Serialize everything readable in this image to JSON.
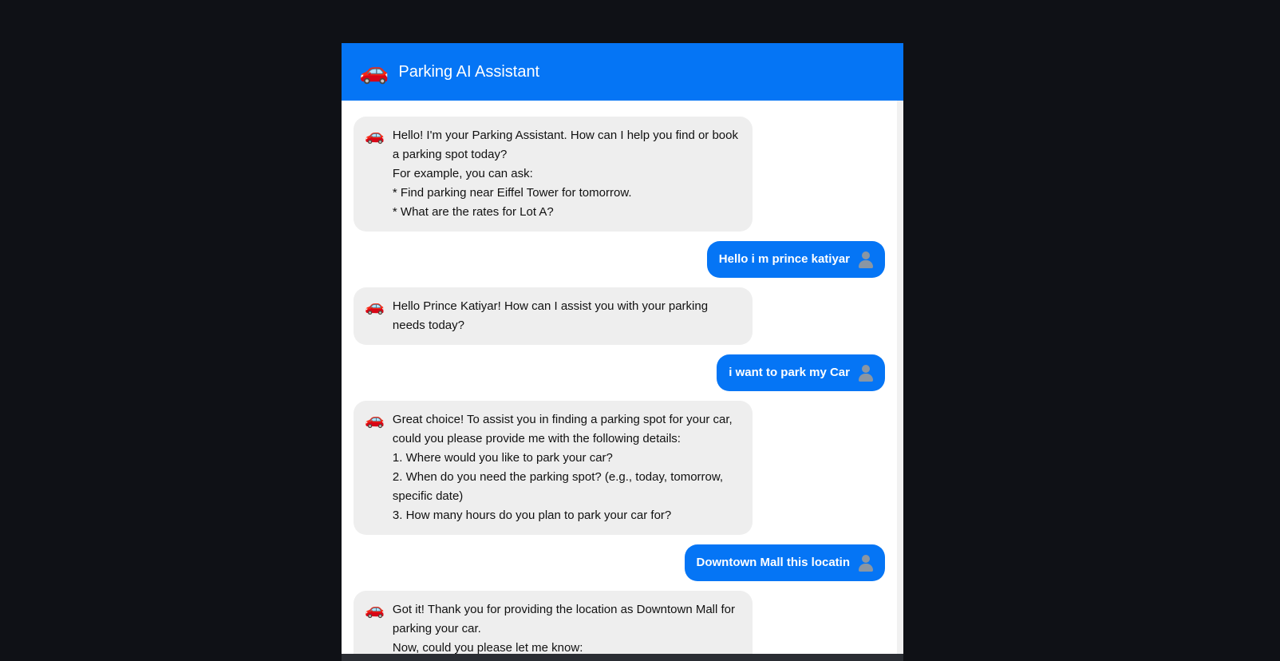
{
  "header": {
    "icon": "🚗",
    "title": "Parking AI Assistant"
  },
  "messages": [
    {
      "role": "bot",
      "icon": "🚗",
      "lines": [
        "Hello! I'm your Parking Assistant. How can I help you find or book a parking spot today?",
        "For example, you can ask:",
        "* Find parking near Eiffel Tower for tomorrow.",
        "* What are the rates for Lot A?"
      ]
    },
    {
      "role": "user",
      "text": "Hello i m prince katiyar"
    },
    {
      "role": "bot",
      "icon": "🚗",
      "lines": [
        "Hello Prince Katiyar! How can I assist you with your parking needs today?"
      ]
    },
    {
      "role": "user",
      "text": "i want to park my Car"
    },
    {
      "role": "bot",
      "icon": "🚗",
      "lines": [
        "Great choice! To assist you in finding a parking spot for your car, could you please provide me with the following details:",
        "1. Where would you like to park your car?",
        "2. When do you need the parking spot? (e.g., today, tomorrow, specific date)",
        "3. How many hours do you plan to park your car for?"
      ]
    },
    {
      "role": "user",
      "text": "Downtown Mall this locatin"
    },
    {
      "role": "bot",
      "icon": "🚗",
      "lines": [
        "Got it! Thank you for providing the location as Downtown Mall for parking your car.",
        "Now, could you please let me know:"
      ]
    }
  ]
}
